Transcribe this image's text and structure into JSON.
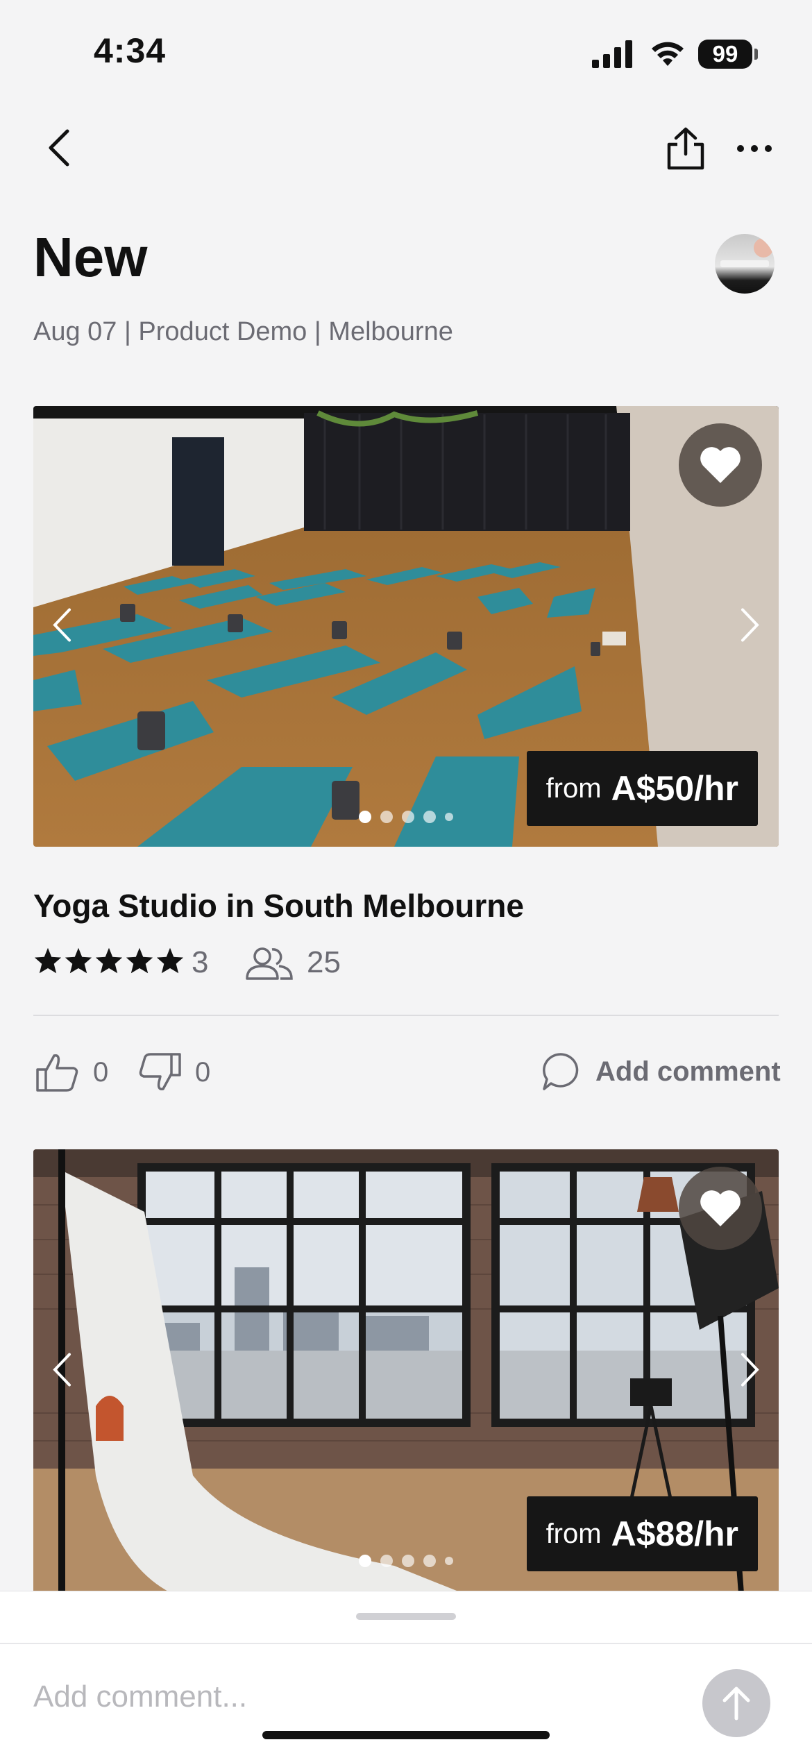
{
  "status_bar": {
    "time": "4:34",
    "battery": "99"
  },
  "header": {
    "title": "New",
    "subtitle": "Aug 07 | Product Demo | Melbourne"
  },
  "listings": [
    {
      "title": "Yoga Studio in South Melbourne",
      "price_from": "from",
      "price": "A$50/hr",
      "rating_count": "3",
      "rating_stars": 5,
      "capacity": "25",
      "likes": "0",
      "dislikes": "0",
      "comment_label": "Add comment",
      "photo_index": 0,
      "photo_count": 5
    },
    {
      "price_from": "from",
      "price": "A$88/hr",
      "photo_index": 0,
      "photo_count": 5
    }
  ],
  "composer": {
    "placeholder": "Add comment..."
  },
  "icons": {
    "back": "chevron-left-icon",
    "share": "share-icon",
    "more": "more-icon",
    "favorite": "heart-icon",
    "star": "star-icon",
    "guests": "people-icon",
    "like": "thumbs-up-icon",
    "dislike": "thumbs-down-icon",
    "comment": "speech-bubble-icon",
    "send": "arrow-up-icon"
  },
  "colors": {
    "background": "#f4f4f5",
    "mat_teal": "#2f8d9a",
    "price_tag": "#161616",
    "muted_text": "#6b6b73"
  }
}
